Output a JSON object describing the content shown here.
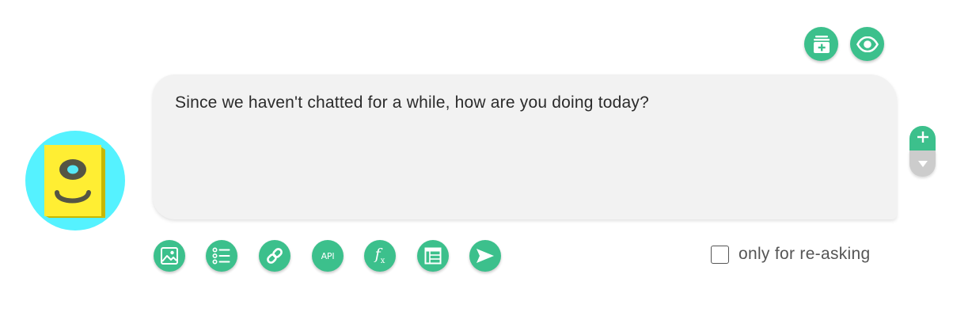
{
  "colors": {
    "accent": "#3cc08c",
    "bubble_bg": "#f2f2f2",
    "avatar_bg": "#55f2ff",
    "avatar_card": "#ffee33",
    "stepper_down": "#cccccc"
  },
  "top_actions": [
    {
      "name": "add-card-button",
      "icon": "add-card-icon"
    },
    {
      "name": "preview-button",
      "icon": "eye-icon"
    }
  ],
  "message": {
    "text": "Since we haven't chatted for a while, how are you doing today?"
  },
  "stepper": {
    "up_icon": "plus-icon",
    "down_icon": "triangle-down-icon"
  },
  "toolbar": {
    "items": [
      {
        "name": "image-button",
        "icon": "image-icon"
      },
      {
        "name": "list-button",
        "icon": "list-icon"
      },
      {
        "name": "link-button",
        "icon": "link-icon"
      },
      {
        "name": "api-button",
        "icon": "api-icon",
        "label": "API"
      },
      {
        "name": "function-button",
        "icon": "function-icon",
        "label": "f",
        "sub": "x"
      },
      {
        "name": "table-button",
        "icon": "table-icon"
      },
      {
        "name": "send-button",
        "icon": "send-icon"
      }
    ]
  },
  "reask": {
    "label": "only for re-asking",
    "checked": false
  }
}
